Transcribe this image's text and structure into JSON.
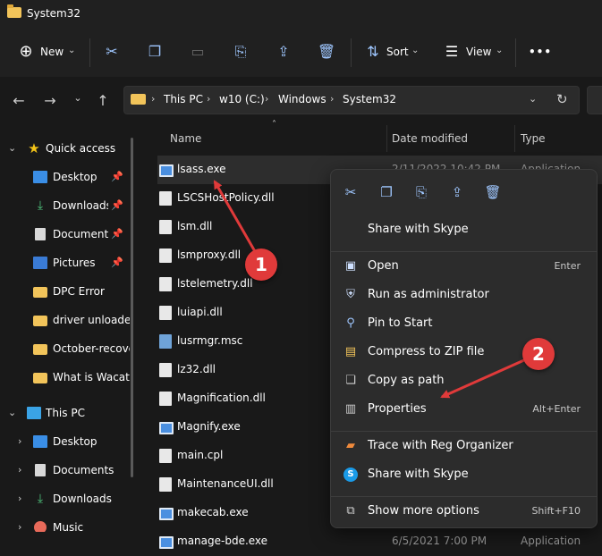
{
  "window": {
    "title": "System32"
  },
  "command_bar": {
    "new_label": "New",
    "sort_label": "Sort",
    "view_label": "View",
    "more": "•••"
  },
  "address": {
    "crumbs": [
      "This PC",
      "w10 (C:)",
      "Windows",
      "System32"
    ]
  },
  "sidebar": {
    "quick_access": "Quick access",
    "quick_items": [
      {
        "label": "Desktop",
        "icon": "desktop-icon",
        "pinned": true
      },
      {
        "label": "Downloads",
        "icon": "download-icon",
        "pinned": true
      },
      {
        "label": "Documents",
        "icon": "documents-icon",
        "pinned": true
      },
      {
        "label": "Pictures",
        "icon": "pictures-icon",
        "pinned": true
      },
      {
        "label": "DPC Error",
        "icon": "folder-icon",
        "pinned": false
      },
      {
        "label": "driver unloaded",
        "icon": "folder-icon",
        "pinned": false
      },
      {
        "label": "October-recove",
        "icon": "folder-icon",
        "pinned": false
      },
      {
        "label": "What is Wacata",
        "icon": "folder-icon",
        "pinned": false
      }
    ],
    "this_pc": "This PC",
    "pc_items": [
      {
        "label": "Desktop",
        "icon": "desktop-icon"
      },
      {
        "label": "Documents",
        "icon": "documents-icon"
      },
      {
        "label": "Downloads",
        "icon": "download-icon"
      },
      {
        "label": "Music",
        "icon": "music-icon"
      }
    ]
  },
  "file_list": {
    "columns": {
      "name": "Name",
      "date": "Date modified",
      "type": "Type"
    },
    "rows": [
      {
        "name": "lsass.exe",
        "date": "2/11/2022 10:42 PM",
        "type": "Application",
        "kind": "exe",
        "selected": true
      },
      {
        "name": "LSCSHostPolicy.dll",
        "date": "",
        "type": "",
        "kind": "dll"
      },
      {
        "name": "lsm.dll",
        "date": "",
        "type": "",
        "kind": "dll"
      },
      {
        "name": "lsmproxy.dll",
        "date": "",
        "type": "",
        "kind": "dll"
      },
      {
        "name": "lstelemetry.dll",
        "date": "",
        "type": "",
        "kind": "dll"
      },
      {
        "name": "luiapi.dll",
        "date": "",
        "type": "",
        "kind": "dll"
      },
      {
        "name": "lusrmgr.msc",
        "date": "",
        "type": "",
        "kind": "msc"
      },
      {
        "name": "lz32.dll",
        "date": "",
        "type": "",
        "kind": "dll"
      },
      {
        "name": "Magnification.dll",
        "date": "",
        "type": "",
        "kind": "dll"
      },
      {
        "name": "Magnify.exe",
        "date": "",
        "type": "",
        "kind": "exe"
      },
      {
        "name": "main.cpl",
        "date": "",
        "type": "",
        "kind": "dll"
      },
      {
        "name": "MaintenanceUI.dll",
        "date": "",
        "type": "",
        "kind": "dll"
      },
      {
        "name": "makecab.exe",
        "date": "",
        "type": "",
        "kind": "exe"
      },
      {
        "name": "manage-bde.exe",
        "date": "6/5/2021 7:00 PM",
        "type": "Application",
        "kind": "exe"
      }
    ]
  },
  "context_menu": {
    "items": [
      {
        "label": "Share with Skype",
        "shortcut": "",
        "icon": ""
      },
      {
        "label": "Open",
        "shortcut": "Enter",
        "icon": "open-icon"
      },
      {
        "label": "Run as administrator",
        "shortcut": "",
        "icon": "shield-icon"
      },
      {
        "label": "Pin to Start",
        "shortcut": "",
        "icon": "pin-icon"
      },
      {
        "label": "Compress to ZIP file",
        "shortcut": "",
        "icon": "zip-icon"
      },
      {
        "label": "Copy as path",
        "shortcut": "",
        "icon": "copy-path-icon"
      },
      {
        "label": "Properties",
        "shortcut": "Alt+Enter",
        "icon": "properties-icon"
      },
      {
        "label": "Trace with Reg Organizer",
        "shortcut": "",
        "icon": "reg-organizer-icon"
      },
      {
        "label": "Share with Skype",
        "shortcut": "",
        "icon": "skype-icon"
      },
      {
        "label": "Show more options",
        "shortcut": "Shift+F10",
        "icon": "more-options-icon"
      }
    ]
  },
  "annotations": {
    "badge1": "1",
    "badge2": "2"
  },
  "colors": {
    "accent": "#9fc7ff",
    "badge": "#e03a3a",
    "folder": "#f2c45a"
  }
}
